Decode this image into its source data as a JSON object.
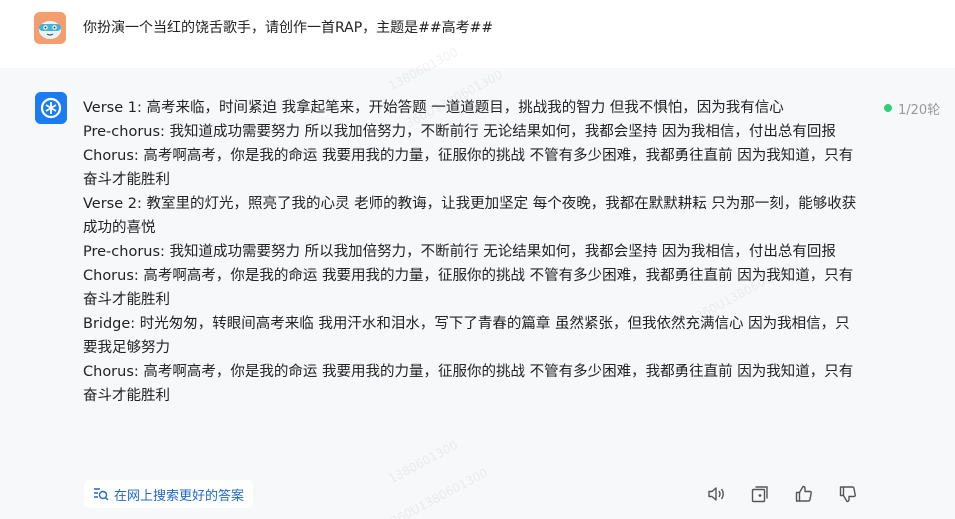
{
  "user_message": {
    "text": "你扮演一个当红的饶舌歌手，请创作一首RAP，主题是##高考##"
  },
  "assistant_message": {
    "lines": [
      "Verse 1: 高考来临，时间紧迫 我拿起笔来，开始答题 一道道题目，挑战我的智力 但我不惧怕，因为我有信心",
      "Pre-chorus: 我知道成功需要努力 所以我加倍努力，不断前行 无论结果如何，我都会坚持 因为我相信，付出总有回报",
      "Chorus: 高考啊高考，你是我的命运 我要用我的力量，征服你的挑战 不管有多少困难，我都勇往直前 因为我知道，只有奋斗才能胜利",
      "Verse 2: 教室里的灯光，照亮了我的心灵 老师的教诲，让我更加坚定 每个夜晚，我都在默默耕耘 只为那一刻，能够收获成功的喜悦",
      "Pre-chorus: 我知道成功需要努力 所以我加倍努力，不断前行 无论结果如何，我都会坚持 因为我相信，付出总有回报",
      "Chorus: 高考啊高考，你是我的命运 我要用我的力量，征服你的挑战 不管有多少困难，我都勇往直前 因为我知道，只有奋斗才能胜利",
      "Bridge: 时光匆匆，转眼间高考来临 我用汗水和泪水，写下了青春的篇章 虽然紧张，但我依然充满信心 因为我相信，只要我足够努力",
      "Chorus: 高考啊高考，你是我的命运 我要用我的力量，征服你的挑战 不管有多少困难，我都勇往直前 因为我知道，只有奋斗才能胜利"
    ]
  },
  "round_indicator": {
    "text": "1/20轮",
    "color": "#2fcf7c"
  },
  "search_better": {
    "label": "在网上搜索更好的答案",
    "icon": "search-list-icon"
  },
  "actions": {
    "icons": [
      "speaker-icon",
      "copy-icon",
      "thumbs-up-icon",
      "thumbs-down-icon"
    ]
  },
  "watermark": {
    "text": "360U1380601300",
    "text_short": "1380601300"
  }
}
